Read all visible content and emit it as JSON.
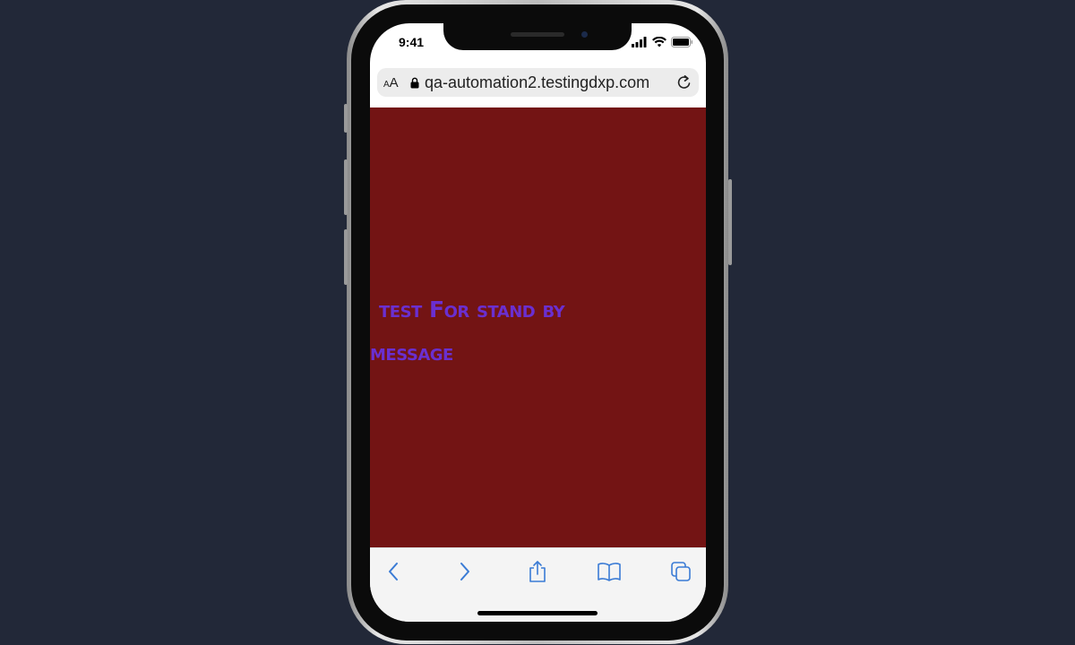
{
  "status_bar": {
    "time": "9:41"
  },
  "browser": {
    "text_size_small": "A",
    "text_size_large": "A",
    "url": "qa-automation2.testingdxp.com"
  },
  "page": {
    "message": "test For stand by message",
    "background_color": "#731414",
    "text_color": "#6a2fd0"
  },
  "toolbar": {
    "icons": [
      "back-icon",
      "forward-icon",
      "share-icon",
      "bookmarks-icon",
      "tabs-icon"
    ],
    "accent_color": "#3a7bd5"
  }
}
